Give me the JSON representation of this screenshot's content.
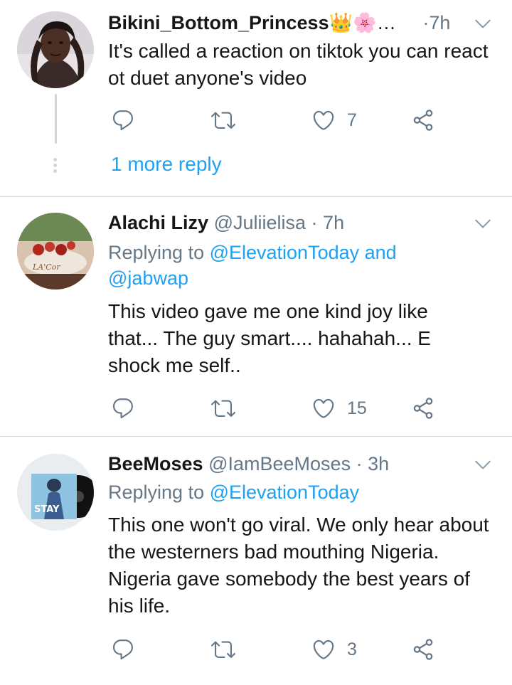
{
  "tweets": [
    {
      "display_name": "Bikini_Bottom_Princess",
      "name_emoji": "👑🌸…",
      "handle": "",
      "time": "7h",
      "replying_prefix": "",
      "replying_mentions": "",
      "text": "It's called a reaction on tiktok you can react ot duet anyone's video",
      "actions": {
        "reply_count": "",
        "retweet_count": "",
        "like_count": "7"
      },
      "more_replies": "1 more reply"
    },
    {
      "display_name": "Alachi Lizy",
      "handle": "@Juliielisa",
      "time": "7h",
      "replying_prefix": "Replying to ",
      "replying_mentions": "@ElevationToday and @jabwap",
      "text": "This video gave me one kind joy like that... The guy smart.... hahahah... E shock me self..",
      "actions": {
        "reply_count": "",
        "retweet_count": "",
        "like_count": "15"
      }
    },
    {
      "display_name": "BeeMoses",
      "handle": "@IamBeeMoses",
      "time": "3h",
      "replying_prefix": "Replying to ",
      "replying_mentions": "@ElevationToday",
      "text": "This one won't go viral. We only hear about the westerners bad mouthing Nigeria. Nigeria gave somebody the best years of his life.",
      "actions": {
        "reply_count": "",
        "retweet_count": "",
        "like_count": "3"
      }
    }
  ],
  "separator": "·",
  "colors": {
    "link": "#1da1f2",
    "muted": "#657786",
    "text": "#14171a",
    "divider": "#d9dde1"
  },
  "icons": [
    "reply-icon",
    "retweet-icon",
    "like-icon",
    "share-icon",
    "chevron-down-icon"
  ]
}
